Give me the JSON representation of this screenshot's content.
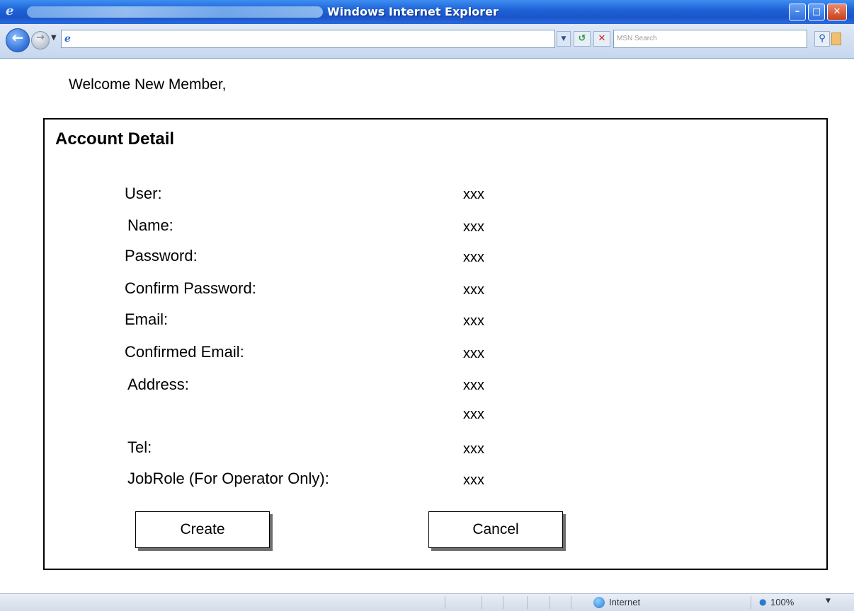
{
  "window": {
    "title": "Windows Internet Explorer",
    "minimize_glyph": "–",
    "maximize_glyph": "□",
    "close_glyph": "✕"
  },
  "toolbar": {
    "address_value": "",
    "search_placeholder": "MSN Search",
    "icons": [
      "back-icon",
      "forward-icon",
      "refresh-icon",
      "stop-icon",
      "search-icon"
    ]
  },
  "page": {
    "welcome": "Welcome New Member,",
    "panel_title": "Account Detail",
    "fields": [
      {
        "label": "User:",
        "value": "xxx"
      },
      {
        "label": "Name:",
        "value": "xxx"
      },
      {
        "label": "Password:",
        "value": "xxx"
      },
      {
        "label": "Confirm Password:",
        "value": "xxx"
      },
      {
        "label": "Email:",
        "value": "xxx"
      },
      {
        "label": "Confirmed Email:",
        "value": "xxx"
      },
      {
        "label": "Address:",
        "value": "xxx"
      },
      {
        "label": "",
        "value": "xxx"
      },
      {
        "label": "Tel:",
        "value": "xxx"
      },
      {
        "label": "JobRole (For Operator Only):",
        "value": "xxx"
      }
    ],
    "create_label": "Create",
    "cancel_label": "Cancel"
  },
  "status": {
    "zone": "Internet",
    "zoom": "100%"
  },
  "colors": {
    "titlebar": "#1f63d8",
    "panel_border": "#000000",
    "button_shadow": "#6e6e6e"
  }
}
